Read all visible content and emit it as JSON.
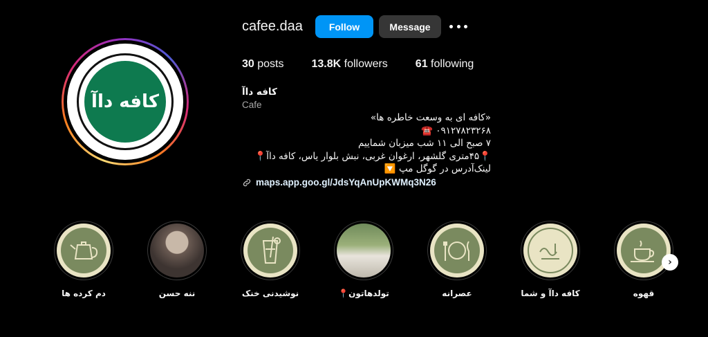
{
  "profile": {
    "username": "cafee.daa",
    "follow_label": "Follow",
    "message_label": "Message",
    "more_icon": "more-options-icon",
    "logo_text": "کافه داآ"
  },
  "stats": {
    "posts_count": "30",
    "posts_label": "posts",
    "followers_count": "13.8K",
    "followers_label": "followers",
    "following_count": "61",
    "following_label": "following"
  },
  "bio": {
    "name": "کافه داآ",
    "category": "Cafe",
    "lines": [
      "«کافه ای به وسعت خاطره ها»",
      "☎️ ۰۹۱۲۷۸۲۳۲۶۸",
      "۷ صبح الی ۱۱ شب میزبان شماییم",
      "📍۴۵متری گلشهر، ارغوان غربی، نبش بلوار یاس، کافه داآ📍",
      "لینک‌آدرس در گوگل مپ 🔽"
    ],
    "link": "maps.app.goo.gl/JdsYqAnUpKWMq3N26",
    "link_icon": "link-icon"
  },
  "highlights": [
    {
      "label": "دم کرده ها",
      "icon": "teapot-icon"
    },
    {
      "label": "ننه حسن",
      "icon": "grandma-illustration"
    },
    {
      "label": "نوشیدنی خنک",
      "icon": "cold-drink-icon"
    },
    {
      "label": "تولدهاتون📍",
      "icon": "birthday-photo"
    },
    {
      "label": "عصرانه",
      "icon": "plate-cutlery-icon"
    },
    {
      "label": "کافه داآ و شما",
      "icon": "cafe-logo-icon"
    },
    {
      "label": "قهوه",
      "icon": "coffee-cup-icon"
    }
  ],
  "colors": {
    "follow_button": "#0095f6",
    "message_button": "#363636",
    "logo_green": "#0e7a4f",
    "highlight_disc": "#7a8a5f",
    "highlight_ring": "#e9e4c4"
  }
}
